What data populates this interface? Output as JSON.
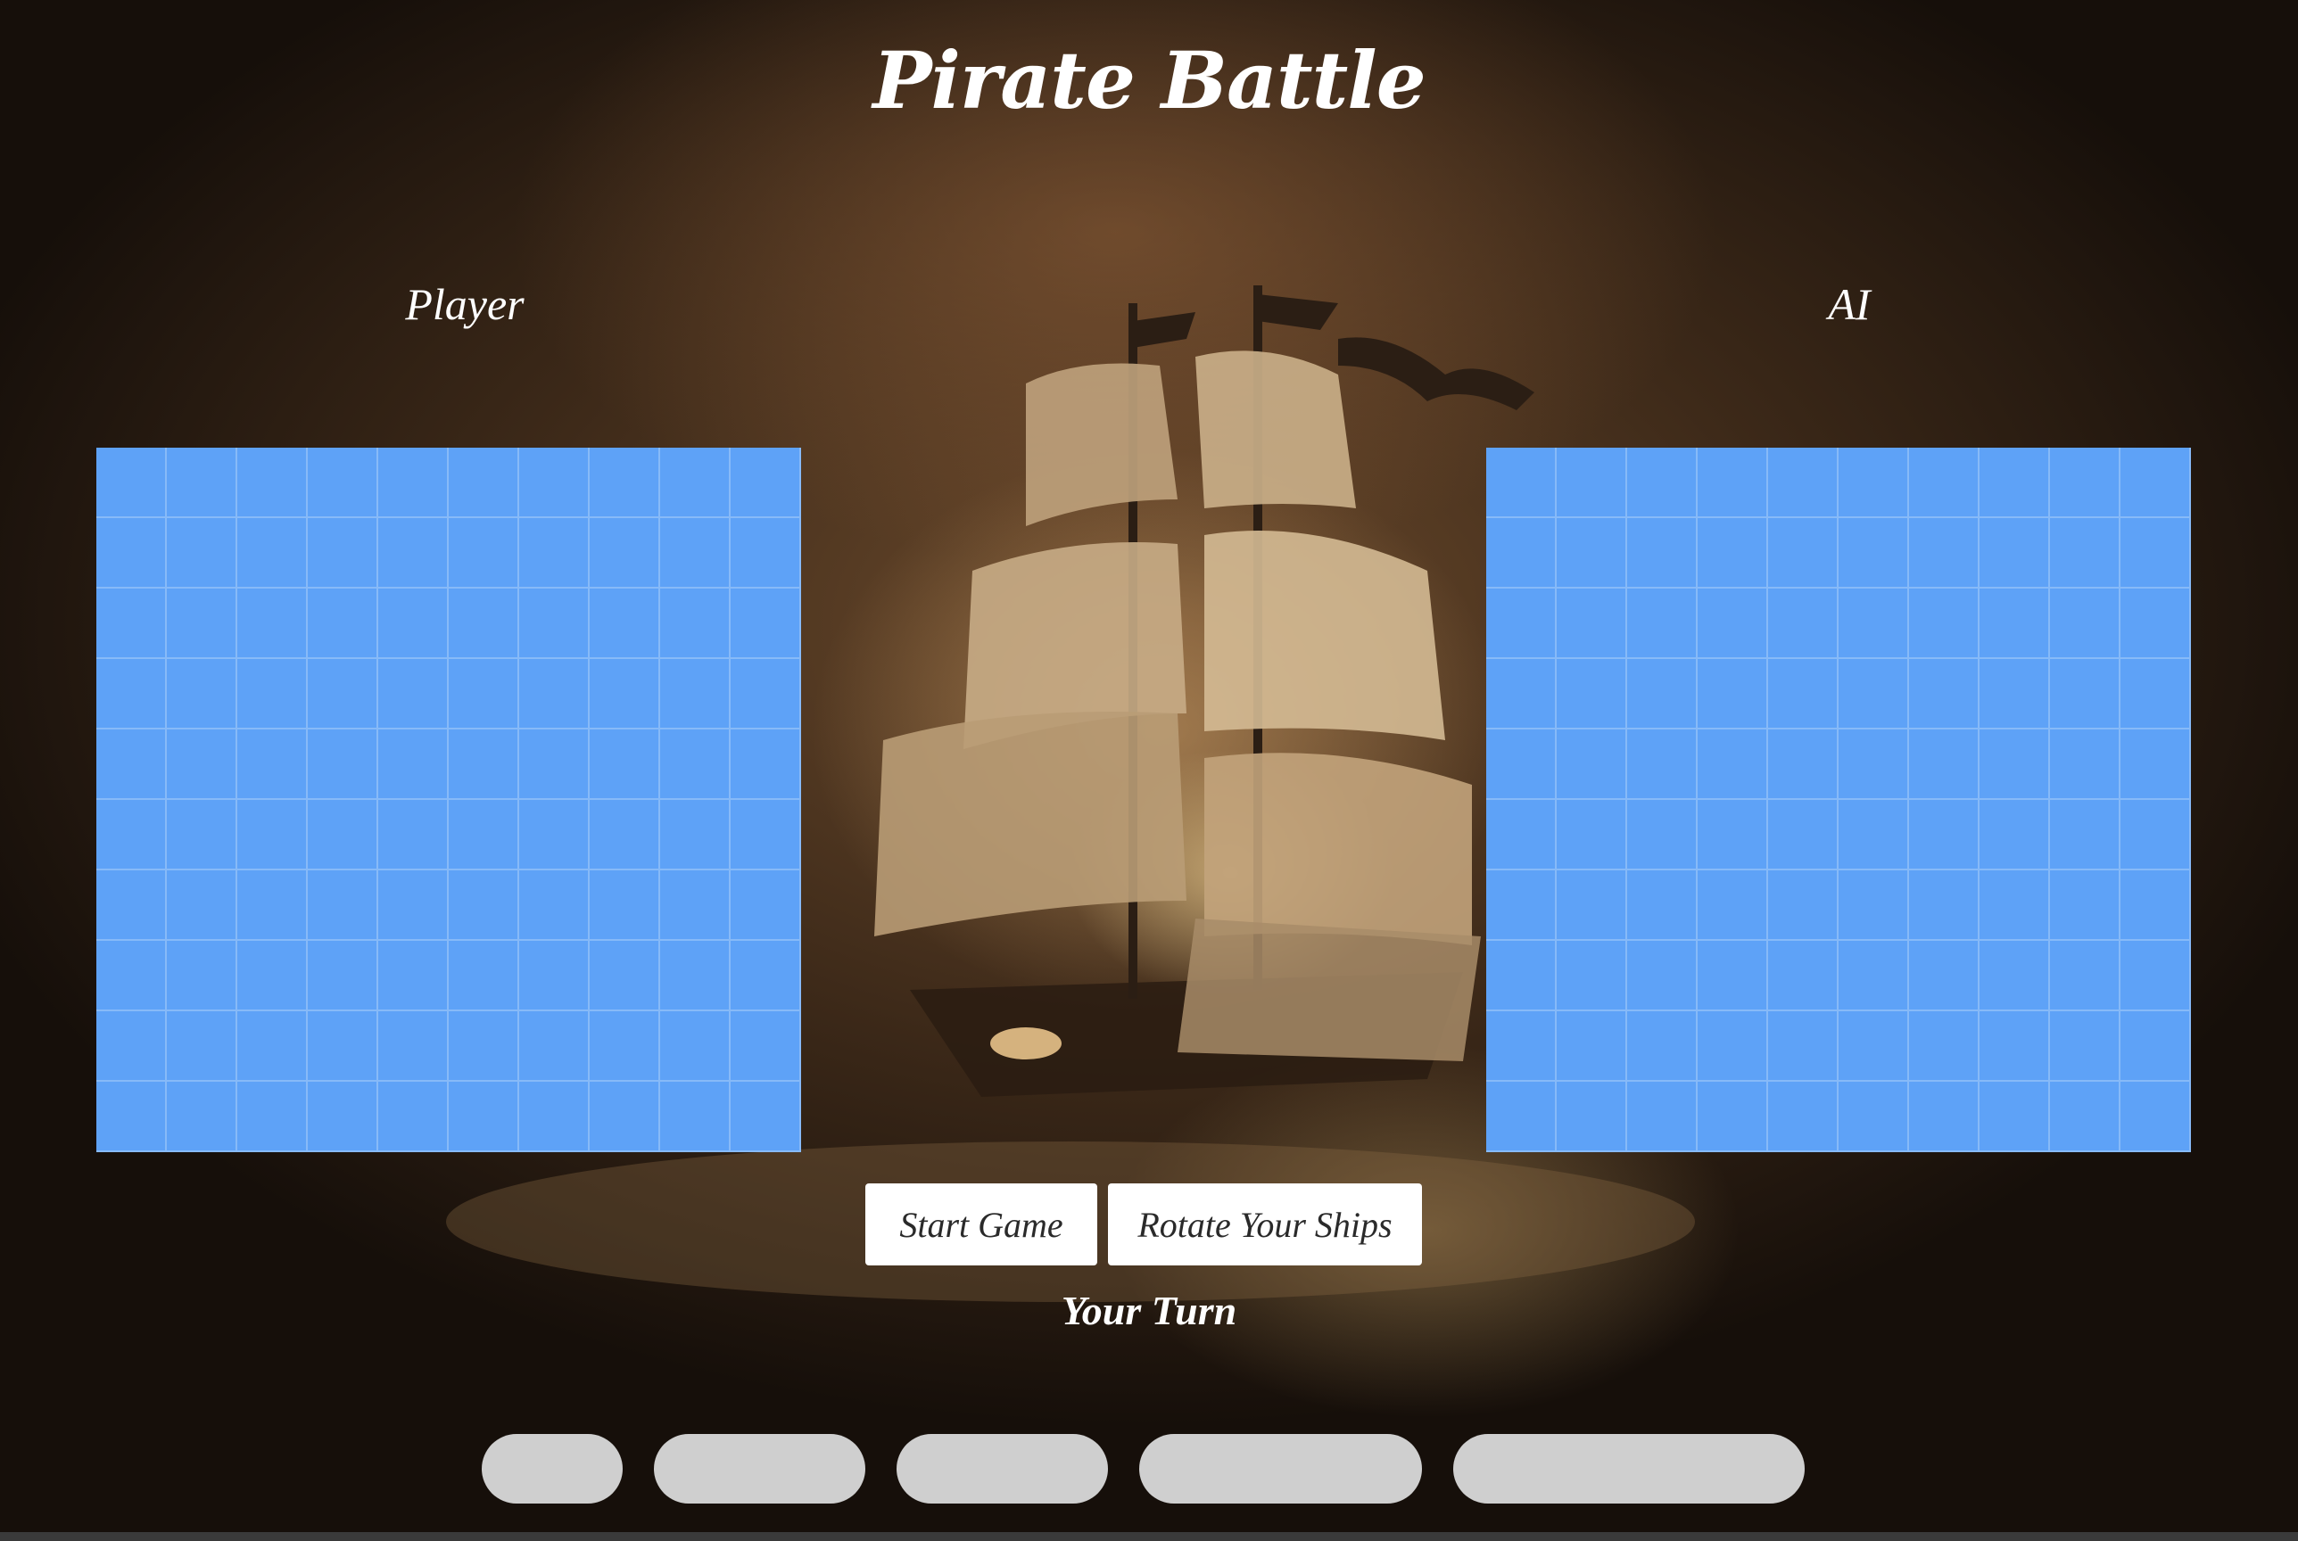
{
  "game": {
    "title": "Pirate Battle",
    "turn_status": "Your Turn"
  },
  "boards": {
    "player": {
      "label": "Player",
      "rows": 10,
      "cols": 10
    },
    "ai": {
      "label": "AI",
      "rows": 10,
      "cols": 10
    }
  },
  "controls": {
    "start_label": "Start Game",
    "rotate_label": "Rotate Your Ships"
  },
  "ship_tray": {
    "count": 5
  },
  "colors": {
    "board": "#5ea2f7",
    "grid_line": "#aacdfa",
    "pill": "#cfcfcf",
    "text": "#ffffff"
  }
}
